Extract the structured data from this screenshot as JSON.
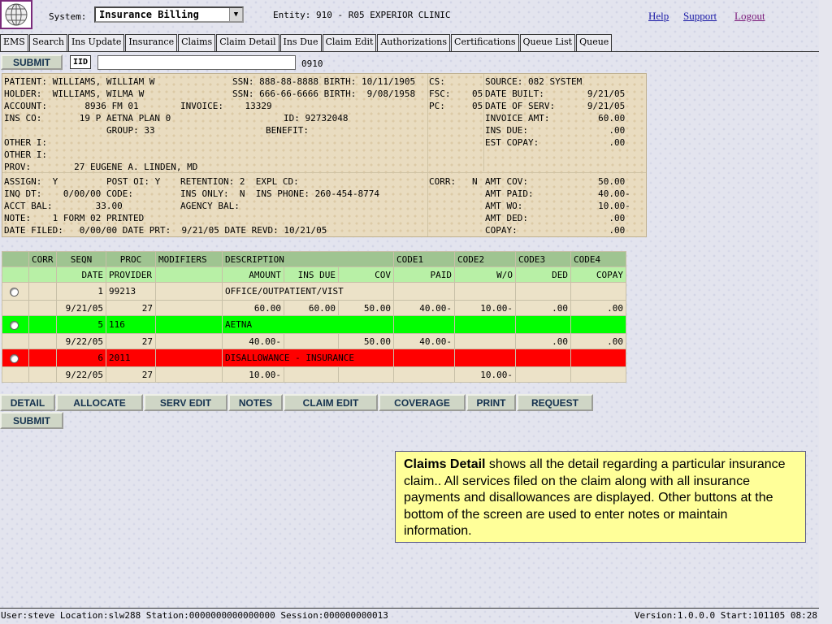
{
  "header": {
    "system_label": "System:",
    "system_value": "Insurance Billing",
    "entity": "Entity: 910 - R05 EXPERIOR CLINIC",
    "links": {
      "help": "Help",
      "support": "Support",
      "logout": "Logout"
    }
  },
  "tabs": [
    "EMS",
    "Search",
    "Ins Update",
    "Insurance",
    "Claims",
    "Claim Detail",
    "Ins Due",
    "Claim Edit",
    "Authorizations",
    "Certifications",
    "Queue List",
    "Queue"
  ],
  "toolbar": {
    "submit": "SUBMIT",
    "iid_label": "IID",
    "iid_value": "",
    "iid_code": "0910"
  },
  "info": {
    "patient": "PATIENT: WILLIAMS, WILLIAM W",
    "patient_ssn": "SSN: 888-88-8888 BIRTH: 10/11/1905",
    "cs": "CS:",
    "source": "SOURCE: 082 SYSTEM",
    "holder": "HOLDER:  WILLIAMS, WILMA W",
    "holder_ssn": "SSN: 666-66-6666 BIRTH:  9/08/1958",
    "fsc": "FSC:    05",
    "date_built": "DATE BUILT:        9/21/05",
    "account": "ACCOUNT:       8936 FM 01",
    "invoice": "INVOICE:    13329",
    "pc": "PC:     05",
    "date_serv": "DATE OF SERV:      9/21/05",
    "ins_co": "INS CO:       19 P AETNA PLAN 0",
    "ins_id": "ID: 92732048",
    "invoice_amt": "INVOICE AMT:         60.00",
    "group": "GROUP: 33",
    "benefit": "BENEFIT:",
    "ins_due": "INS DUE:               .00",
    "other1": "OTHER I:",
    "est_copay": "EST COPAY:             .00",
    "other2": "OTHER I:",
    "prov": "PROV:        27 EUGENE A. LINDEN, MD",
    "assign": "ASSIGN:  Y",
    "post_oi": "POST OI: Y",
    "retention": "RETENTION: 2  EXPL CD:",
    "corr": "CORR:   N",
    "amt_cov": "AMT COV:             50.00",
    "inq_dt": "INQ DT:    0/00/00 CODE:",
    "ins_only": "INS ONLY:  N  INS PHONE: 260-454-8774",
    "amt_paid": "AMT PAID:            40.00-",
    "acct_bal": "ACCT BAL:        33.00",
    "agency_bal": "AGENCY BAL:",
    "amt_wo": "AMT WO:              10.00-",
    "note": "NOTE:    1 FORM 02 PRINTED",
    "amt_ded": "AMT DED:               .00",
    "date_filed": "DATE FILED:   0/00/00 DATE PRT:  9/21/05 DATE REVD: 10/21/05",
    "copay": "COPAY:                 .00"
  },
  "table": {
    "header1": [
      "",
      "CORR",
      "SEQN",
      "PROC",
      "MODIFIERS",
      "DESCRIPTION",
      "CODE1",
      "CODE2",
      "CODE3",
      "CODE4"
    ],
    "header2": [
      "",
      "",
      "DATE",
      "PROVIDER",
      "",
      "AMOUNT",
      "INS DUE",
      "COV",
      "PAID",
      "W/O",
      "DED",
      "COPAY"
    ],
    "rows": [
      {
        "line1": {
          "seqn": "1",
          "proc": "99213",
          "modifiers": "",
          "desc": "OFFICE/OUTPATIENT/VIST"
        },
        "line2": {
          "date": "9/21/05",
          "provider": "27",
          "amount": "60.00",
          "ins_due": "60.00",
          "cov": "50.00",
          "paid": "40.00-",
          "wo": "10.00-",
          "ded": ".00",
          "copay": ".00"
        }
      },
      {
        "line1": {
          "seqn": "5",
          "proc": "116",
          "modifiers": "",
          "desc": "AETNA"
        },
        "line2": {
          "date": "9/22/05",
          "provider": "27",
          "amount": "40.00-",
          "ins_due": "",
          "cov": "50.00",
          "paid": "40.00-",
          "wo": "",
          "ded": ".00",
          "copay": ".00"
        }
      },
      {
        "line1": {
          "seqn": "6",
          "proc": "2011",
          "modifiers": "",
          "desc": "DISALLOWANCE - INSURANCE"
        },
        "line2": {
          "date": "9/22/05",
          "provider": "27",
          "amount": "10.00-",
          "ins_due": "",
          "cov": "",
          "paid": "",
          "wo": "10.00-",
          "ded": "",
          "copay": ""
        }
      }
    ]
  },
  "actions": [
    "DETAIL",
    "ALLOCATE",
    "SERV EDIT",
    "NOTES",
    "CLAIM EDIT",
    "COVERAGE",
    "PRINT",
    "REQUEST"
  ],
  "submit_bottom": "SUBMIT",
  "note": {
    "title": "Claims Detail",
    "body": " shows all the detail regarding a particular insurance claim..  All services filed on the claim along with all insurance payments and disallowances are displayed.  Other buttons at the bottom of the screen are used to enter notes or maintain information."
  },
  "status": {
    "left": "User:steve Location:slw288 Station:0000000000000000 Session:000000000013",
    "right": "Version:1.0.0.0  Start:101105 08:28"
  },
  "colors": {
    "green_row": "#00ff00",
    "red_row": "#ff0000",
    "header_green": "#9fc491",
    "subheader_green": "#b8f0a6",
    "panel_beige": "#e9dcc0",
    "note_yellow": "#ffff99"
  }
}
